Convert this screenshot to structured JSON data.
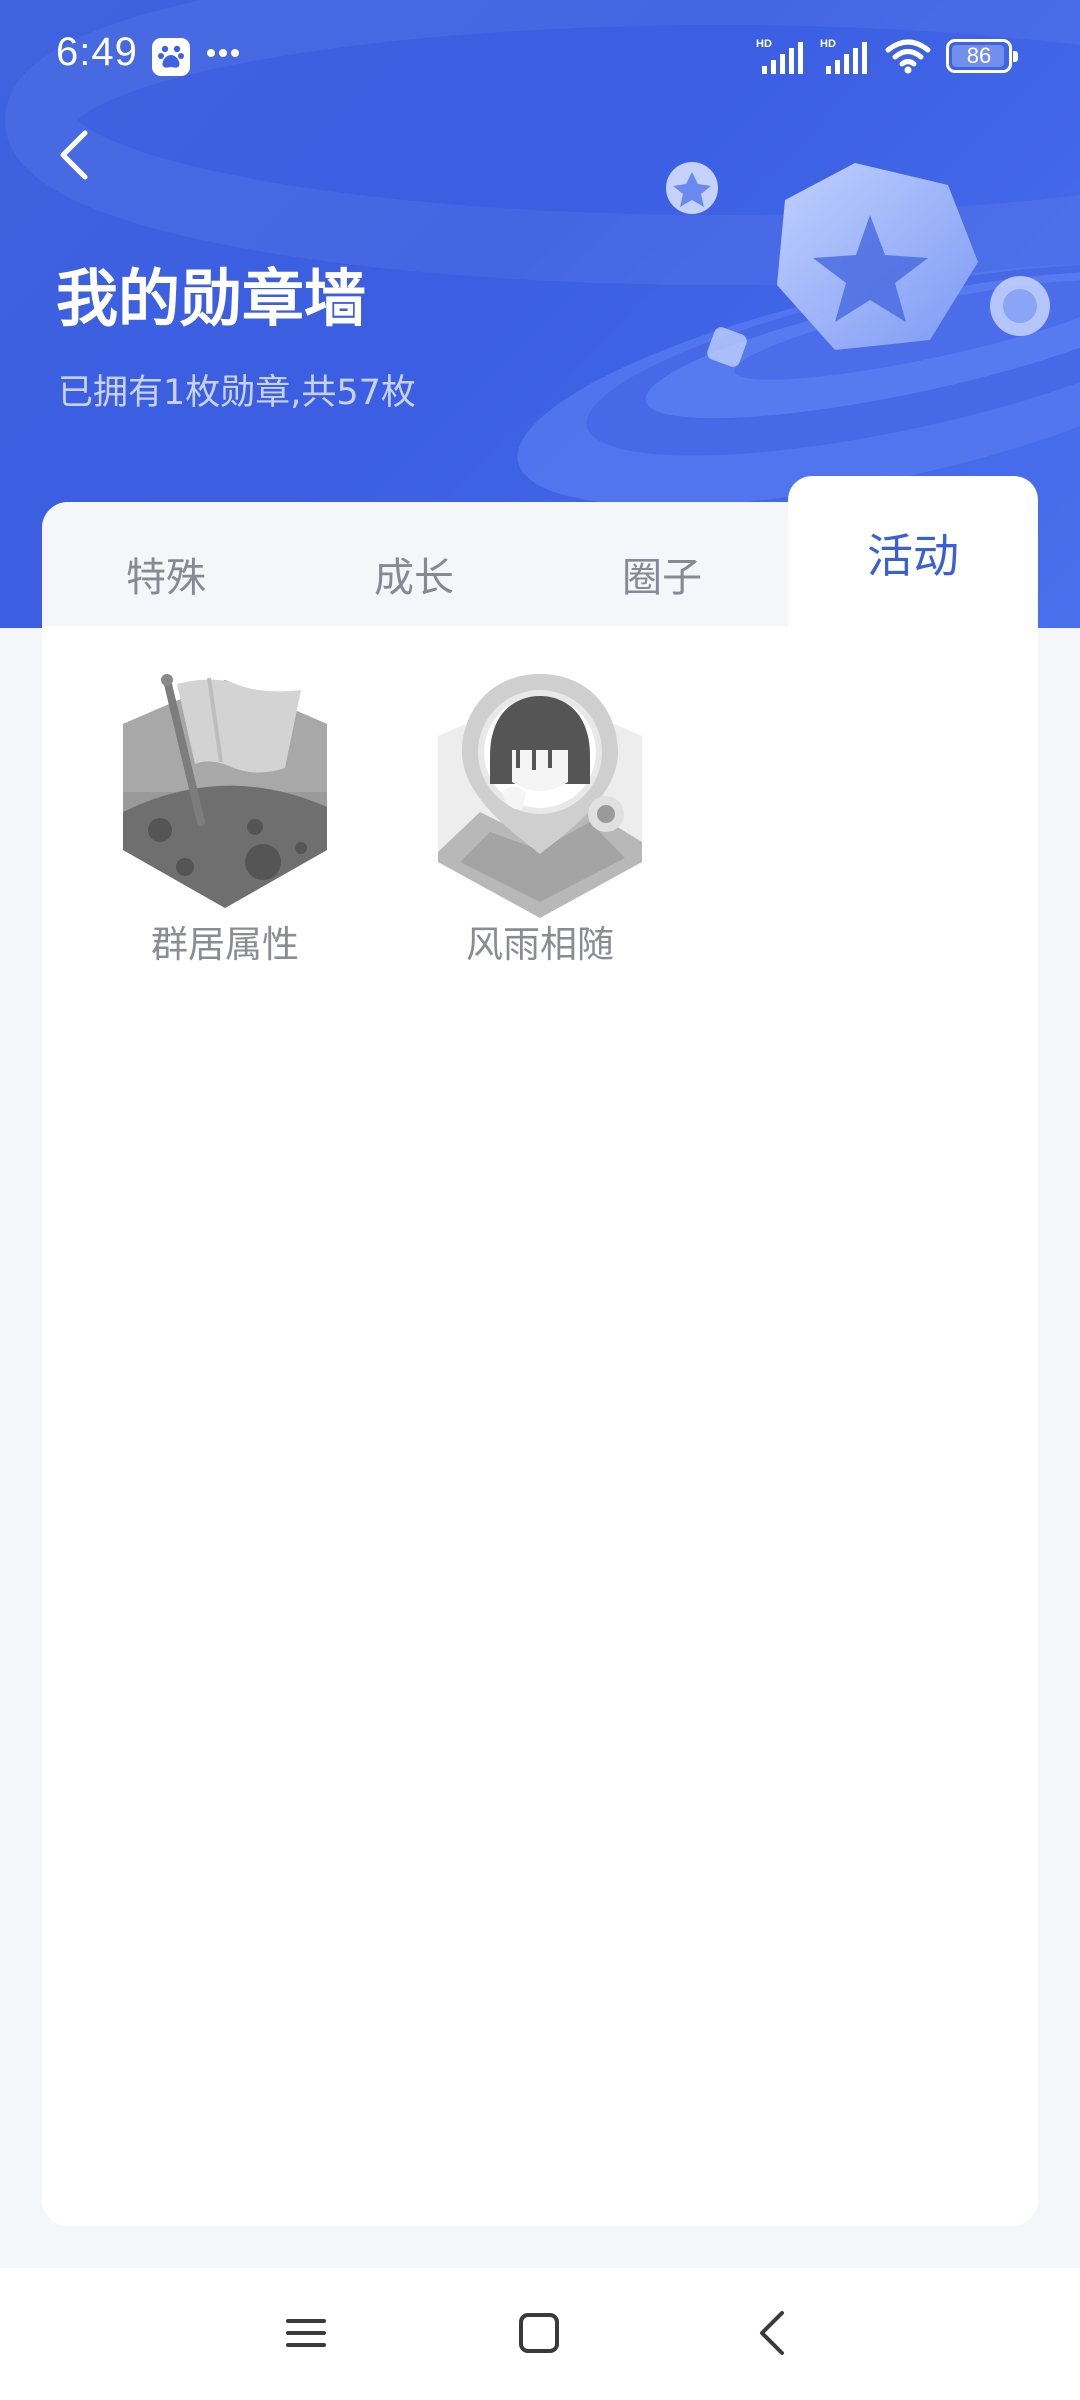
{
  "status_bar": {
    "time": "6:49",
    "battery": "86",
    "battery_level": 0.86,
    "icons": [
      "baidu-app-icon",
      "more-dots-icon",
      "hd-signal-icon",
      "hd-signal-icon",
      "wifi-icon",
      "battery-icon"
    ]
  },
  "header": {
    "title": "我的勋章墙",
    "subtitle": "已拥有1枚勋章,共57枚",
    "back_icon": "chevron-left-icon"
  },
  "tabs": [
    {
      "label": "特殊",
      "active": false
    },
    {
      "label": "成长",
      "active": false
    },
    {
      "label": "圈子",
      "active": false
    },
    {
      "label": "活动",
      "active": true
    }
  ],
  "badges": [
    {
      "name": "群居属性",
      "icon": "moon-flag-badge-icon"
    },
    {
      "name": "风雨相随",
      "icon": "girl-location-badge-icon"
    }
  ],
  "nav_bar": {
    "icons": [
      "menu-icon",
      "home-square-icon",
      "back-chevron-icon"
    ]
  },
  "colors": {
    "header_blue": "#3f62e0",
    "active_tab": "#3a5fd8",
    "inactive_tab": "#878a93",
    "page_background": "#f4f6fa"
  }
}
